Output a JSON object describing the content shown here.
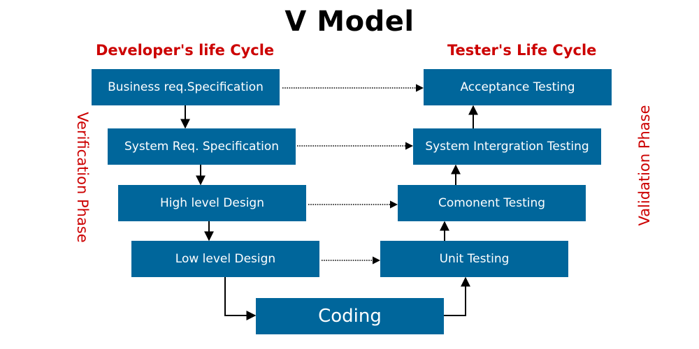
{
  "title": "V Model",
  "developer_lifecycle_label": "Developer's life Cycle",
  "tester_lifecycle_label": "Tester's Life Cycle",
  "verification_phase_label": "Verification Phase",
  "validation_phase_label": "Validation Phase",
  "colors": {
    "box_fill": "#00669b",
    "box_text": "#ffffff",
    "accent_red": "#cc0000",
    "arrow": "#000000"
  },
  "left_stages": [
    {
      "label": "Business req.Specification"
    },
    {
      "label": "System Req. Specification"
    },
    {
      "label": "High level Design"
    },
    {
      "label": "Low level Design"
    }
  ],
  "right_stages": [
    {
      "label": "Acceptance Testing"
    },
    {
      "label": "System Intergration Testing"
    },
    {
      "label": "Comonent Testing"
    },
    {
      "label": "Unit Testing"
    }
  ],
  "bottom_stage": {
    "label": "Coding"
  },
  "connections": [
    {
      "from": "Business req.Specification",
      "to": "System Req. Specification",
      "style": "solid"
    },
    {
      "from": "System Req. Specification",
      "to": "High level Design",
      "style": "solid"
    },
    {
      "from": "High level Design",
      "to": "Low level Design",
      "style": "solid"
    },
    {
      "from": "Low level Design",
      "to": "Coding",
      "style": "solid"
    },
    {
      "from": "Coding",
      "to": "Unit Testing",
      "style": "solid"
    },
    {
      "from": "Unit Testing",
      "to": "Comonent Testing",
      "style": "solid"
    },
    {
      "from": "Comonent Testing",
      "to": "System Intergration Testing",
      "style": "solid"
    },
    {
      "from": "System Intergration Testing",
      "to": "Acceptance Testing",
      "style": "solid"
    },
    {
      "from": "Business req.Specification",
      "to": "Acceptance Testing",
      "style": "dotted"
    },
    {
      "from": "System Req. Specification",
      "to": "System Intergration Testing",
      "style": "dotted"
    },
    {
      "from": "High level Design",
      "to": "Comonent Testing",
      "style": "dotted"
    },
    {
      "from": "Low level Design",
      "to": "Unit Testing",
      "style": "dotted"
    }
  ]
}
